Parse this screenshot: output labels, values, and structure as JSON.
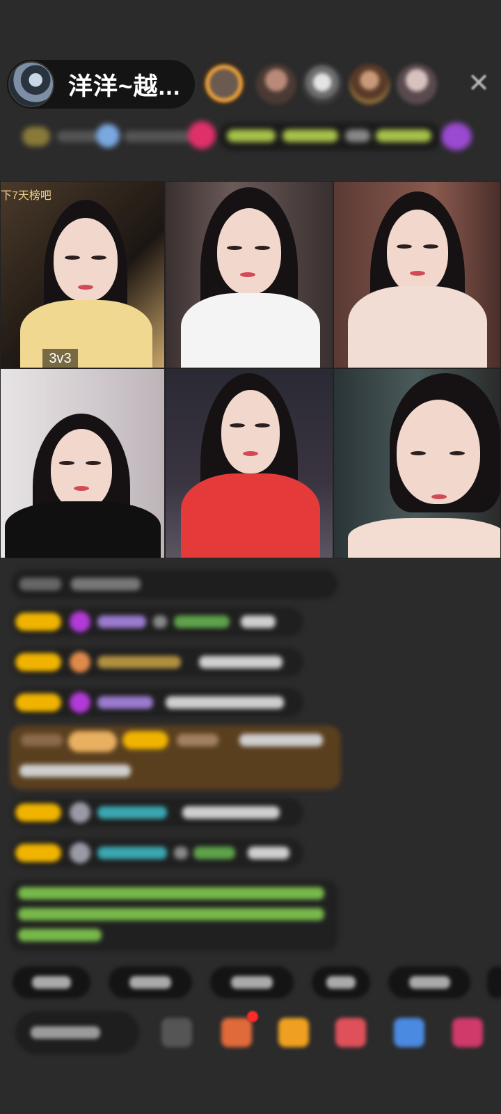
{
  "header": {
    "host_name": "洋洋~越..."
  },
  "grid": {
    "tile1_overlay_text": "下7天榜吧",
    "tile1_badge": "3v3"
  },
  "icons": {
    "close": "close-icon"
  },
  "colors": {
    "background": "#2b2b2b",
    "level_badge": "#f0b400",
    "gift_message_bg": "#5a3f1f",
    "system_text": "#77b84a"
  }
}
